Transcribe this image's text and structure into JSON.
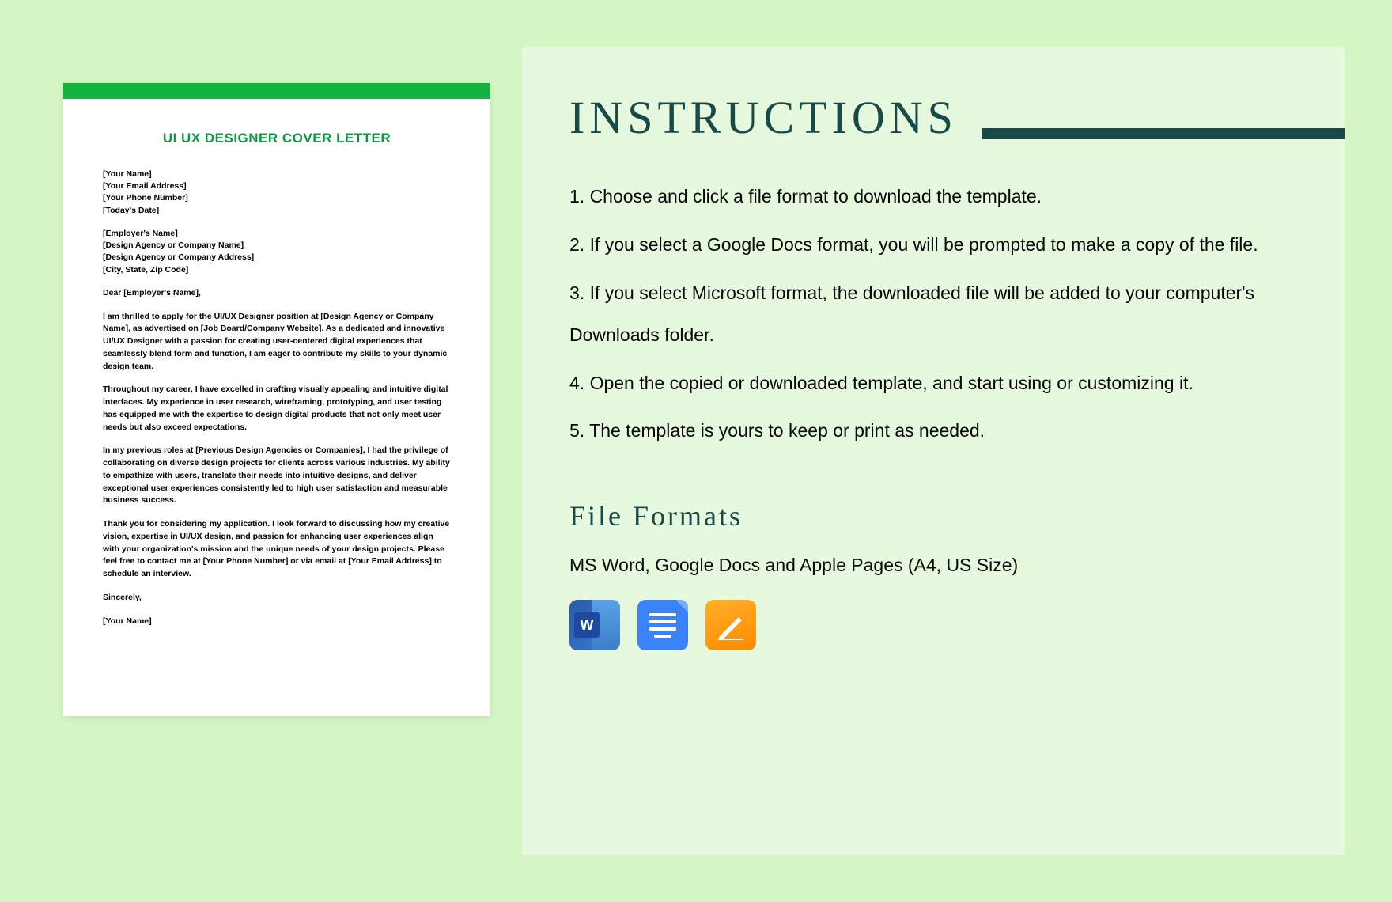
{
  "letter": {
    "title": "UI UX DESIGNER COVER LETTER",
    "sender": {
      "name": "[Your Name]",
      "email": "[Your Email Address]",
      "phone": "[Your Phone Number]",
      "date": "[Today's Date]"
    },
    "recipient": {
      "name": "[Employer's Name]",
      "company": "[Design Agency or Company Name]",
      "address": "[Design Agency or Company Address]",
      "city": "[City, State, Zip Code]"
    },
    "salutation": "Dear [Employer's Name],",
    "paragraphs": {
      "p1": "I am thrilled to apply for the UI/UX Designer position at [Design Agency or Company Name], as advertised on [Job Board/Company Website]. As a dedicated and innovative UI/UX Designer with a passion for creating user-centered digital experiences that seamlessly blend form and function, I am eager to contribute my skills to your dynamic design team.",
      "p2": "Throughout my career, I have excelled in crafting visually appealing and intuitive digital interfaces. My experience in user research, wireframing, prototyping, and user testing has equipped me with the expertise to design digital products that not only meet user needs but also exceed expectations.",
      "p3": "In my previous roles at [Previous Design Agencies or Companies], I had the privilege of collaborating on diverse design projects for clients across various industries. My ability to empathize with users, translate their needs into intuitive designs, and deliver exceptional user experiences consistently led to high user satisfaction and measurable business success.",
      "p4": "Thank you for considering my application. I look forward to discussing how my creative vision, expertise in UI/UX design, and passion for enhancing user experiences align with your organization's mission and the unique needs of your design projects. Please feel free to contact me at [Your Phone Number] or via email at [Your Email Address] to schedule an interview."
    },
    "closing": "Sincerely,",
    "signature": "[Your Name]"
  },
  "instructions": {
    "heading": "INSTRUCTIONS",
    "items": {
      "i1": "1. Choose and click a file format to download the template.",
      "i2": "2. If you select a Google Docs format, you will be prompted to make a copy of the file.",
      "i3": "3. If you select Microsoft format, the downloaded file will be added to your computer's Downloads folder.",
      "i4": "4. Open the copied or downloaded template, and start using or customizing it.",
      "i5": "5. The template is yours to keep or print as needed."
    },
    "file_formats_heading": "File Formats",
    "file_formats_text": "MS Word, Google Docs and Apple Pages (A4, US Size)",
    "icons": {
      "word": "W"
    }
  }
}
